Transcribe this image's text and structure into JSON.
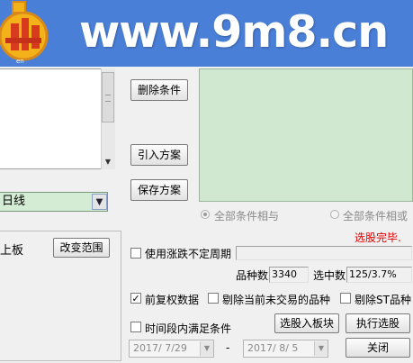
{
  "banner": {
    "text": "www.9m8.cn"
  },
  "left_panel": {
    "period_value": "日线",
    "board_label": "上板",
    "change_range_label": "改变范围"
  },
  "buttons": {
    "delete": "删除条件",
    "import": "引入方案",
    "save": "保存方案",
    "select_to_block": "选股入板块",
    "execute": "执行选股",
    "close": "关闭"
  },
  "radios": {
    "all_and": "全部条件相与",
    "all_or": "全部条件相或"
  },
  "status": {
    "done": "选股完毕."
  },
  "options": {
    "use_variable_period": "使用涨跌不定周期",
    "forward_adjust": "前复权数据",
    "exclude_not_traded": "剔除当前未交易的品种",
    "exclude_st": "剔除ST品种",
    "time_range": "时间段内满足条件"
  },
  "stats": {
    "count_label": "品种数",
    "count_value": "3340",
    "selected_label": "选中数",
    "selected_value": "125/3.7%"
  },
  "dates": {
    "start": "2017/ 7/29",
    "end": "2017/ 8/ 5",
    "separator": "-"
  },
  "colors": {
    "banner": "#4a7fd8",
    "green_area": "#cfe8cf",
    "status_red": "#e00000"
  }
}
